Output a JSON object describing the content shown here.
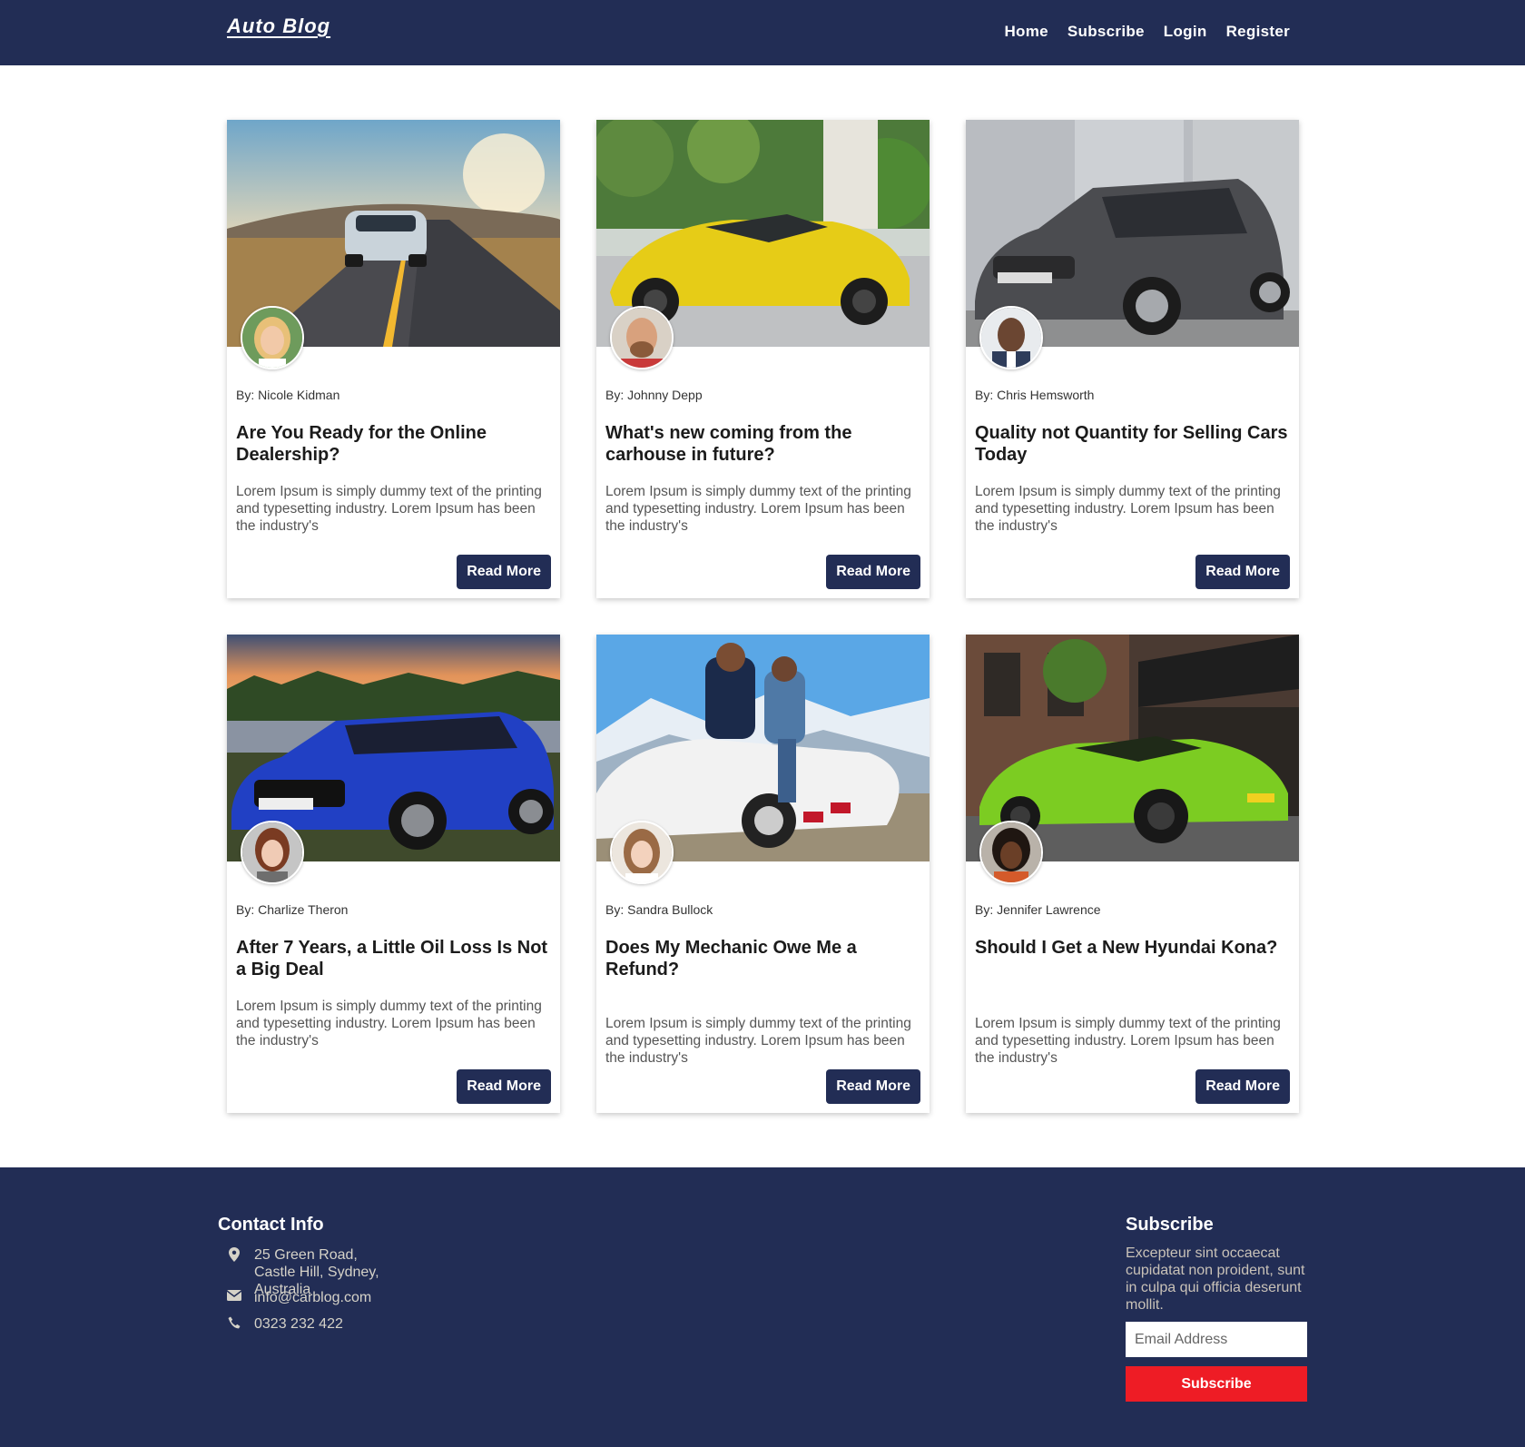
{
  "header": {
    "logo": "Auto Blog",
    "nav": [
      "Home",
      "Subscribe",
      "Login",
      "Register"
    ]
  },
  "posts": [
    {
      "author": "By: Nicole Kidman",
      "title": "Are You Ready for the Online Dealership?",
      "excerpt": "Lorem Ipsum is simply dummy text of the printing and typesetting industry. Lorem Ipsum has been the industry's",
      "button": "Read More"
    },
    {
      "author": "By: Johnny Depp",
      "title": "What's new coming from the carhouse in future?",
      "excerpt": "Lorem Ipsum is simply dummy text of the printing and typesetting industry. Lorem Ipsum has been the industry's",
      "button": "Read More"
    },
    {
      "author": "By: Chris Hemsworth",
      "title": "Quality not Quantity for Selling Cars Today",
      "excerpt": "Lorem Ipsum is simply dummy text of the printing and typesetting industry. Lorem Ipsum has been the industry's",
      "button": "Read More"
    },
    {
      "author": "By: Charlize Theron",
      "title": "After 7 Years, a Little Oil Loss Is Not a Big Deal",
      "excerpt": "Lorem Ipsum is simply dummy text of the printing and typesetting industry. Lorem Ipsum has been the industry's",
      "button": "Read More"
    },
    {
      "author": "By: Sandra Bullock",
      "title": "Does My Mechanic Owe Me a Refund?",
      "excerpt": "Lorem Ipsum is simply dummy text of the printing and typesetting industry. Lorem Ipsum has been the industry's",
      "button": "Read More"
    },
    {
      "author": "By: Jennifer Lawrence",
      "title": "Should I Get a New Hyundai Kona?",
      "excerpt": "Lorem Ipsum is simply dummy text of the printing and typesetting industry. Lorem Ipsum has been the industry's",
      "button": "Read More"
    }
  ],
  "footer": {
    "contact_heading": "Contact Info",
    "address": "25 Green Road, Castle Hill, Sydney, Australia",
    "email": "info@carblog.com",
    "phone": "0323 232 422",
    "subscribe_heading": "Subscribe",
    "subscribe_text": "Excepteur sint occaecat cupidatat non proident, sunt in culpa qui officia deserunt mollit.",
    "email_placeholder": "Email Address",
    "subscribe_button": "Subscribe"
  },
  "colors": {
    "brand_navy": "#222d55",
    "subscribe_red": "#ee1c25"
  },
  "icons": [
    "map-pin-icon",
    "envelope-icon",
    "phone-icon"
  ]
}
